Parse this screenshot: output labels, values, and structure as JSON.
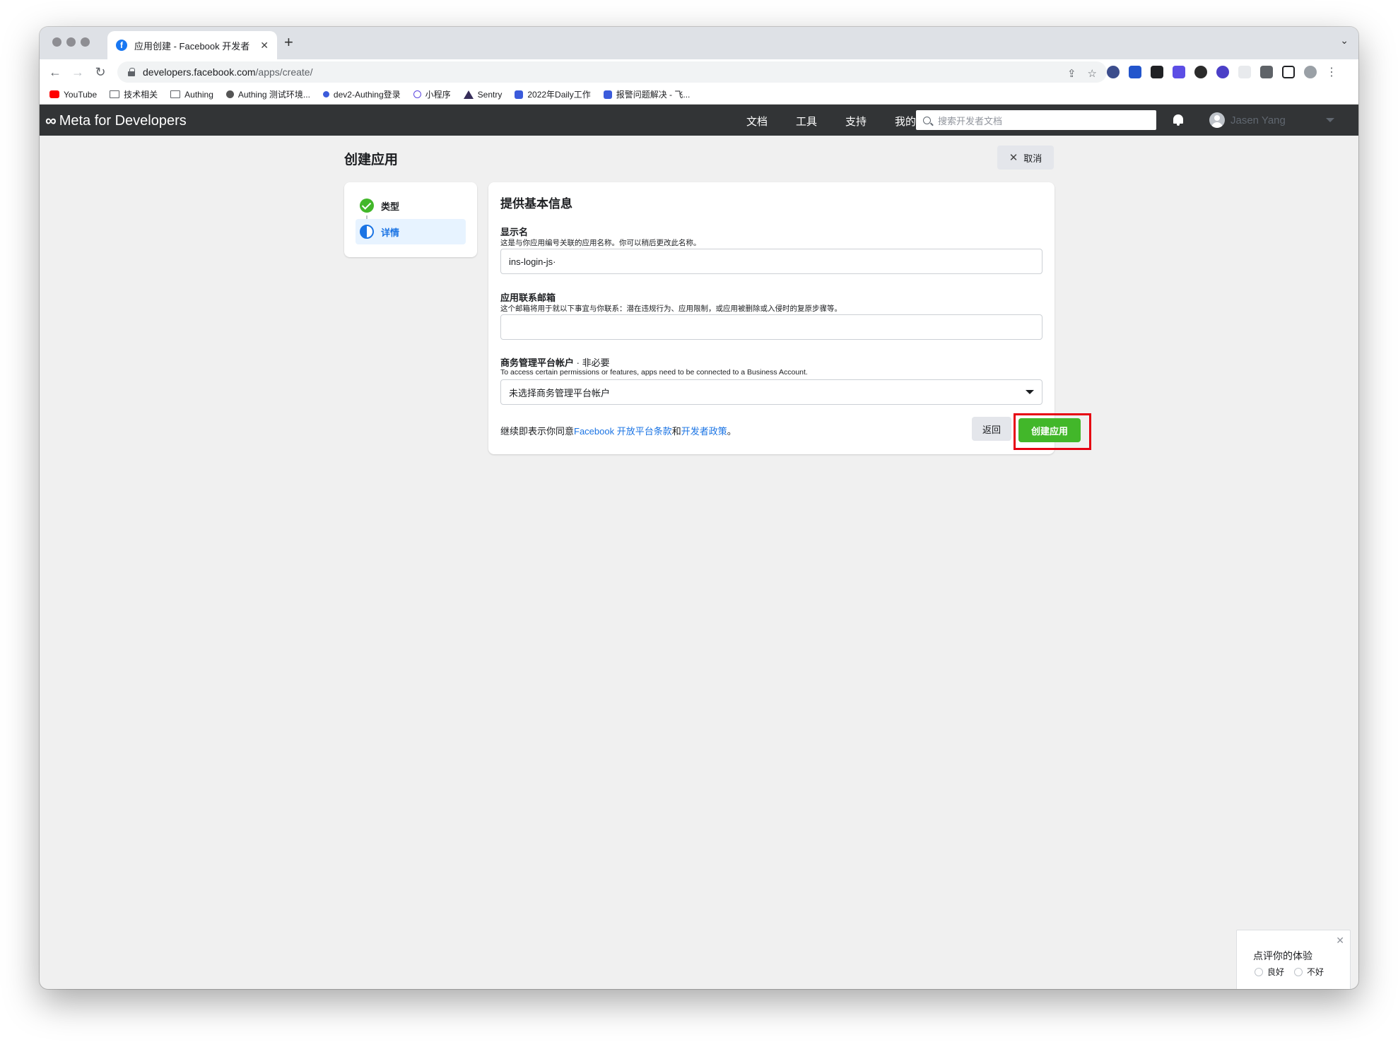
{
  "browser": {
    "tab_title": "应用创建 - Facebook 开发者",
    "tab_icon": "facebook-icon",
    "url_host": "developers.facebook.com",
    "url_path": "/apps/create/"
  },
  "bookmarks": [
    {
      "label": "YouTube",
      "icon": "youtube-icon"
    },
    {
      "label": "技术相关",
      "icon": "folder-icon"
    },
    {
      "label": "Authing",
      "icon": "folder-icon"
    },
    {
      "label": "Authing 测试环境...",
      "icon": "authing-icon"
    },
    {
      "label": "dev2-Authing登录",
      "icon": "dot-icon"
    },
    {
      "label": "小程序",
      "icon": "link-icon"
    },
    {
      "label": "Sentry",
      "icon": "sentry-icon"
    },
    {
      "label": "2022年Daily工作",
      "icon": "doc-icon"
    },
    {
      "label": "报警问题解决 - 飞...",
      "icon": "doc-icon"
    }
  ],
  "nav": {
    "logo": "Meta for Developers",
    "links": [
      "文档",
      "工具",
      "支持",
      "我的应用"
    ],
    "search_placeholder": "搜索开发者文档",
    "user_name": "Jasen Yang"
  },
  "page": {
    "title": "创建应用",
    "cancel_label": "取消"
  },
  "steps": [
    {
      "label": "类型",
      "state": "done"
    },
    {
      "label": "详情",
      "state": "active"
    }
  ],
  "form": {
    "heading": "提供基本信息",
    "display_name_label": "显示名",
    "display_name_help": "这是与你应用编号关联的应用名称。你可以稍后更改此名称。",
    "display_name_value": "ins-login-js·",
    "email_label": "应用联系邮箱",
    "email_help": "这个邮箱将用于就以下事宜与你联系：潜在违规行为、应用限制，或应用被删除或入侵时的复原步骤等。",
    "email_value": "",
    "business_label": "商务管理平台帐户",
    "business_optional": " · 非必要",
    "business_help": "To access certain permissions or features, apps need to be connected to a Business Account.",
    "business_selected": "未选择商务管理平台帐户",
    "terms_prefix": "继续即表示你同意",
    "terms_link1": "Facebook 开放平台条款",
    "terms_mid": "和",
    "terms_link2": "开发者政策",
    "terms_suffix": "。",
    "back_label": "返回",
    "create_label": "创建应用"
  },
  "feedback": {
    "title": "点评你的体验",
    "option_good": "良好",
    "option_bad": "不好"
  },
  "colors": {
    "nav_bg": "#323436",
    "primary_green": "#42b72a",
    "link_blue": "#1b74e4",
    "highlight_red": "#e60012"
  }
}
